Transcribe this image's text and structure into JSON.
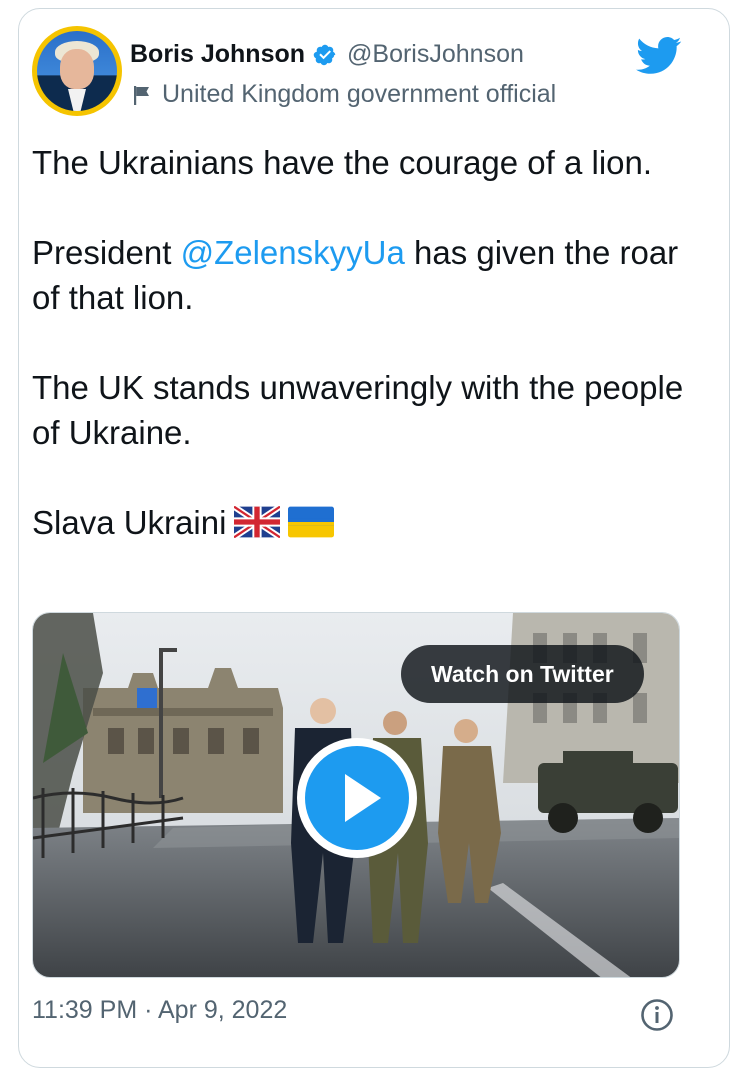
{
  "author": {
    "name": "Boris Johnson",
    "handle": "@BorisJohnson",
    "label": "United Kingdom government official",
    "verified": true
  },
  "icons": {
    "verified": "verified-badge-icon",
    "label": "flag-icon",
    "brand": "twitter-bird-icon",
    "play": "play-icon",
    "info": "info-icon"
  },
  "colors": {
    "accent": "#1d9bf0",
    "text": "#0f1419",
    "secondary": "#536471",
    "border": "#cfd9de"
  },
  "tweet": {
    "line1": "The Ukrainians have the courage of a lion.",
    "p2_before": "President ",
    "p2_mention": "@ZelenskyyUa",
    "p2_after": " has given the roar of that lion.",
    "line3": "The UK stands unwaveringly with the people of Ukraine.",
    "line4": "Slava Ukraini"
  },
  "media": {
    "watch_label": "Watch on Twitter"
  },
  "footer": {
    "timestamp": "11:39 PM · Apr 9, 2022"
  }
}
